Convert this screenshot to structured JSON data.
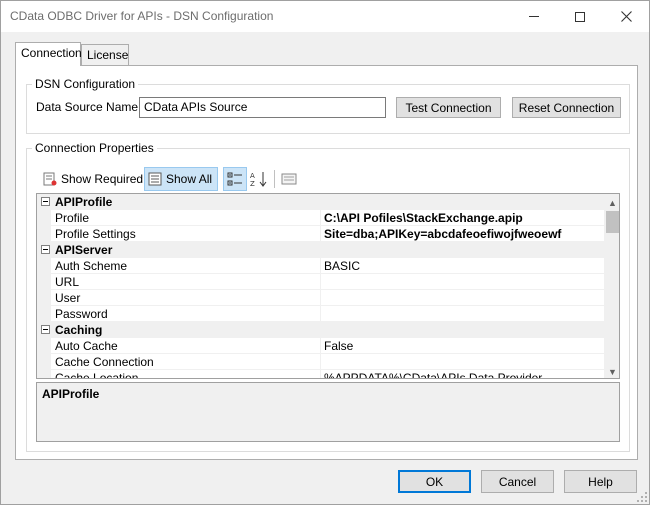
{
  "window": {
    "title": "CData ODBC Driver for APIs - DSN Configuration"
  },
  "tabs": [
    {
      "label": "Connection",
      "active": true
    },
    {
      "label": "License",
      "active": false
    }
  ],
  "dsn": {
    "group_title": "DSN Configuration",
    "label": "Data Source Name:",
    "value": "CData APIs Source",
    "test_button": "Test Connection",
    "reset_button": "Reset Connection"
  },
  "conn": {
    "group_title": "Connection Properties",
    "toolbar": {
      "show_required": "Show Required",
      "show_all": "Show All"
    },
    "grid": {
      "rows": [
        {
          "type": "category",
          "name": "APIProfile"
        },
        {
          "type": "property",
          "name": "Profile",
          "value": "C:\\API Pofiles\\StackExchange.apip",
          "bold": true
        },
        {
          "type": "property",
          "name": "Profile Settings",
          "value": "Site=dba;APIKey=abcdafeoefiwojfweoewf",
          "bold": true
        },
        {
          "type": "category",
          "name": "APIServer"
        },
        {
          "type": "property",
          "name": "Auth Scheme",
          "value": "BASIC"
        },
        {
          "type": "property",
          "name": "URL",
          "value": ""
        },
        {
          "type": "property",
          "name": "User",
          "value": ""
        },
        {
          "type": "property",
          "name": "Password",
          "value": ""
        },
        {
          "type": "category",
          "name": "Caching"
        },
        {
          "type": "property",
          "name": "Auto Cache",
          "value": "False"
        },
        {
          "type": "property",
          "name": "Cache Connection",
          "value": ""
        },
        {
          "type": "property",
          "name": "Cache Location",
          "value": "%APPDATA%\\CData\\APIs Data Provider"
        }
      ]
    },
    "description": {
      "title": "APIProfile"
    }
  },
  "footer": {
    "ok": "OK",
    "cancel": "Cancel",
    "help": "Help"
  }
}
